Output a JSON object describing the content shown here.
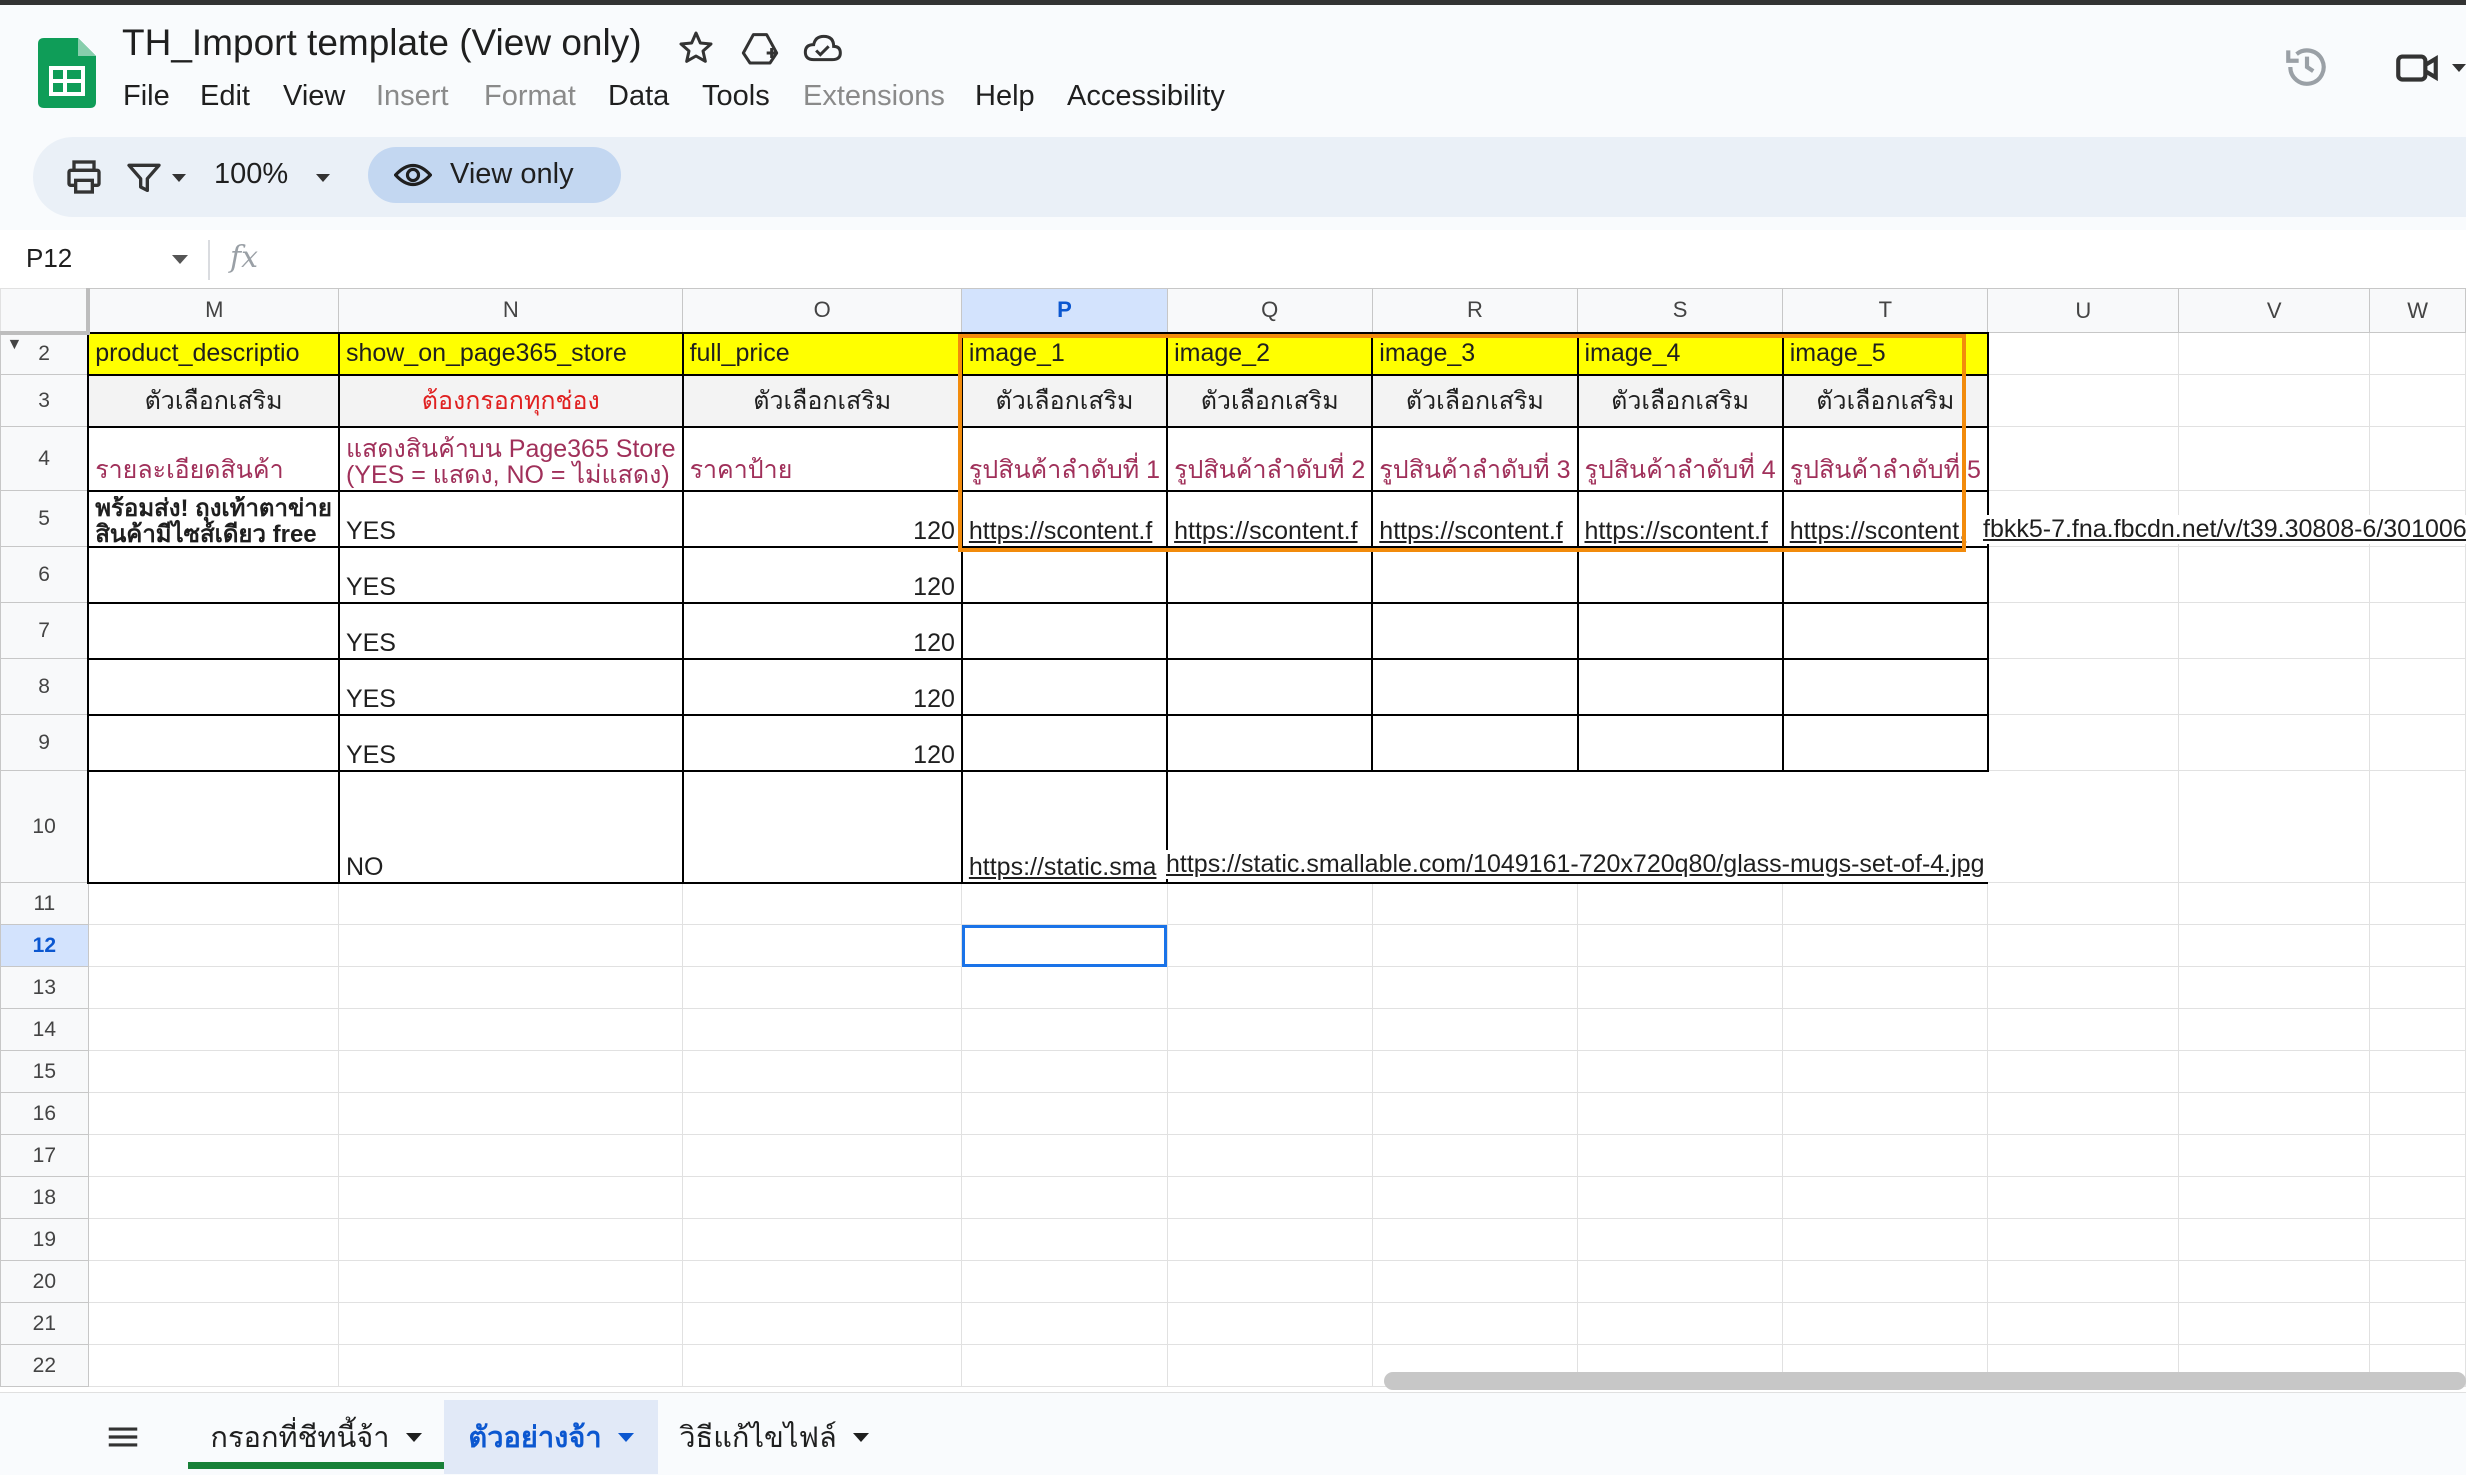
{
  "window": {
    "title": "TH_Import template (View only)"
  },
  "menu": [
    "File",
    "Edit",
    "View",
    "Insert",
    "Format",
    "Data",
    "Tools",
    "Extensions",
    "Help",
    "Accessibility"
  ],
  "menu_disabled": [
    "Insert",
    "Format",
    "Extensions"
  ],
  "toolbar": {
    "zoom": "100%",
    "view_only": "View only"
  },
  "formula_bar": {
    "name_box": "P12",
    "fx": "fx"
  },
  "columns": [
    "M",
    "N",
    "O",
    "P",
    "Q",
    "R",
    "S",
    "T",
    "U",
    "V",
    "W"
  ],
  "selected_column": "P",
  "row_numbers": [
    "2",
    "3",
    "4",
    "5",
    "6",
    "7",
    "8",
    "9",
    "10",
    "11",
    "12",
    "13",
    "14",
    "15",
    "16",
    "17",
    "18",
    "19",
    "20",
    "21",
    "22"
  ],
  "selected_row": "12",
  "cells": {
    "r2": [
      "product_descriptio",
      "show_on_page365_store",
      "full_price",
      "image_1",
      "image_2",
      "image_3",
      "image_4",
      "image_5"
    ],
    "r3": [
      "ตัวเลือกเสริม",
      "ต้องกรอกทุกช่อง",
      "ตัวเลือกเสริม",
      "ตัวเลือกเสริม",
      "ตัวเลือกเสริม",
      "ตัวเลือกเสริม",
      "ตัวเลือกเสริม",
      "ตัวเลือกเสริม"
    ],
    "r4": [
      "รายละเอียดสินค้า",
      "แสดงสินค้าบน Page365 Store",
      "(YES = แสดง, NO = ไม่แสดง)",
      "ราคาป้าย",
      "รูปสินค้าลำดับที่ 1",
      "รูปสินค้าลำดับที่ 2",
      "รูปสินค้าลำดับที่ 3",
      "รูปสินค้าลำดับที่ 4",
      "รูปสินค้าลำดับที่ 5"
    ],
    "r5": [
      "พร้อมส่ง! ถุงเท้าตาข่าย",
      "สินค้ามีไซส์เดียว free",
      "YES",
      "120",
      "https://scontent.f",
      "https://scontent.f",
      "https://scontent.f",
      "https://scontent.f",
      "https://scontent.",
      "fbkk5-7.fna.fbcdn.net/v/t39.30808-6/301006"
    ],
    "r6": [
      "YES",
      "120"
    ],
    "r7": [
      "YES",
      "120"
    ],
    "r8": [
      "YES",
      "120"
    ],
    "r9": [
      "YES",
      "120"
    ],
    "r10": [
      "NO",
      "https://static.sma",
      "https://static.smallable.com/1049161-720x720q80/glass-mugs-set-of-4.jpg"
    ]
  },
  "sheets": [
    {
      "label": "กรอกที่ชีทนี้จ้า",
      "active": false
    },
    {
      "label": "ตัวอย่างจ้า",
      "active": true
    },
    {
      "label": "วิธีแก้ไขไฟล์",
      "active": false
    }
  ],
  "colors": {
    "header_yellow": "#ffff00",
    "highlight_orange": "#f28b0c",
    "selection_blue": "#1a73e8",
    "tab_green": "#188038"
  }
}
